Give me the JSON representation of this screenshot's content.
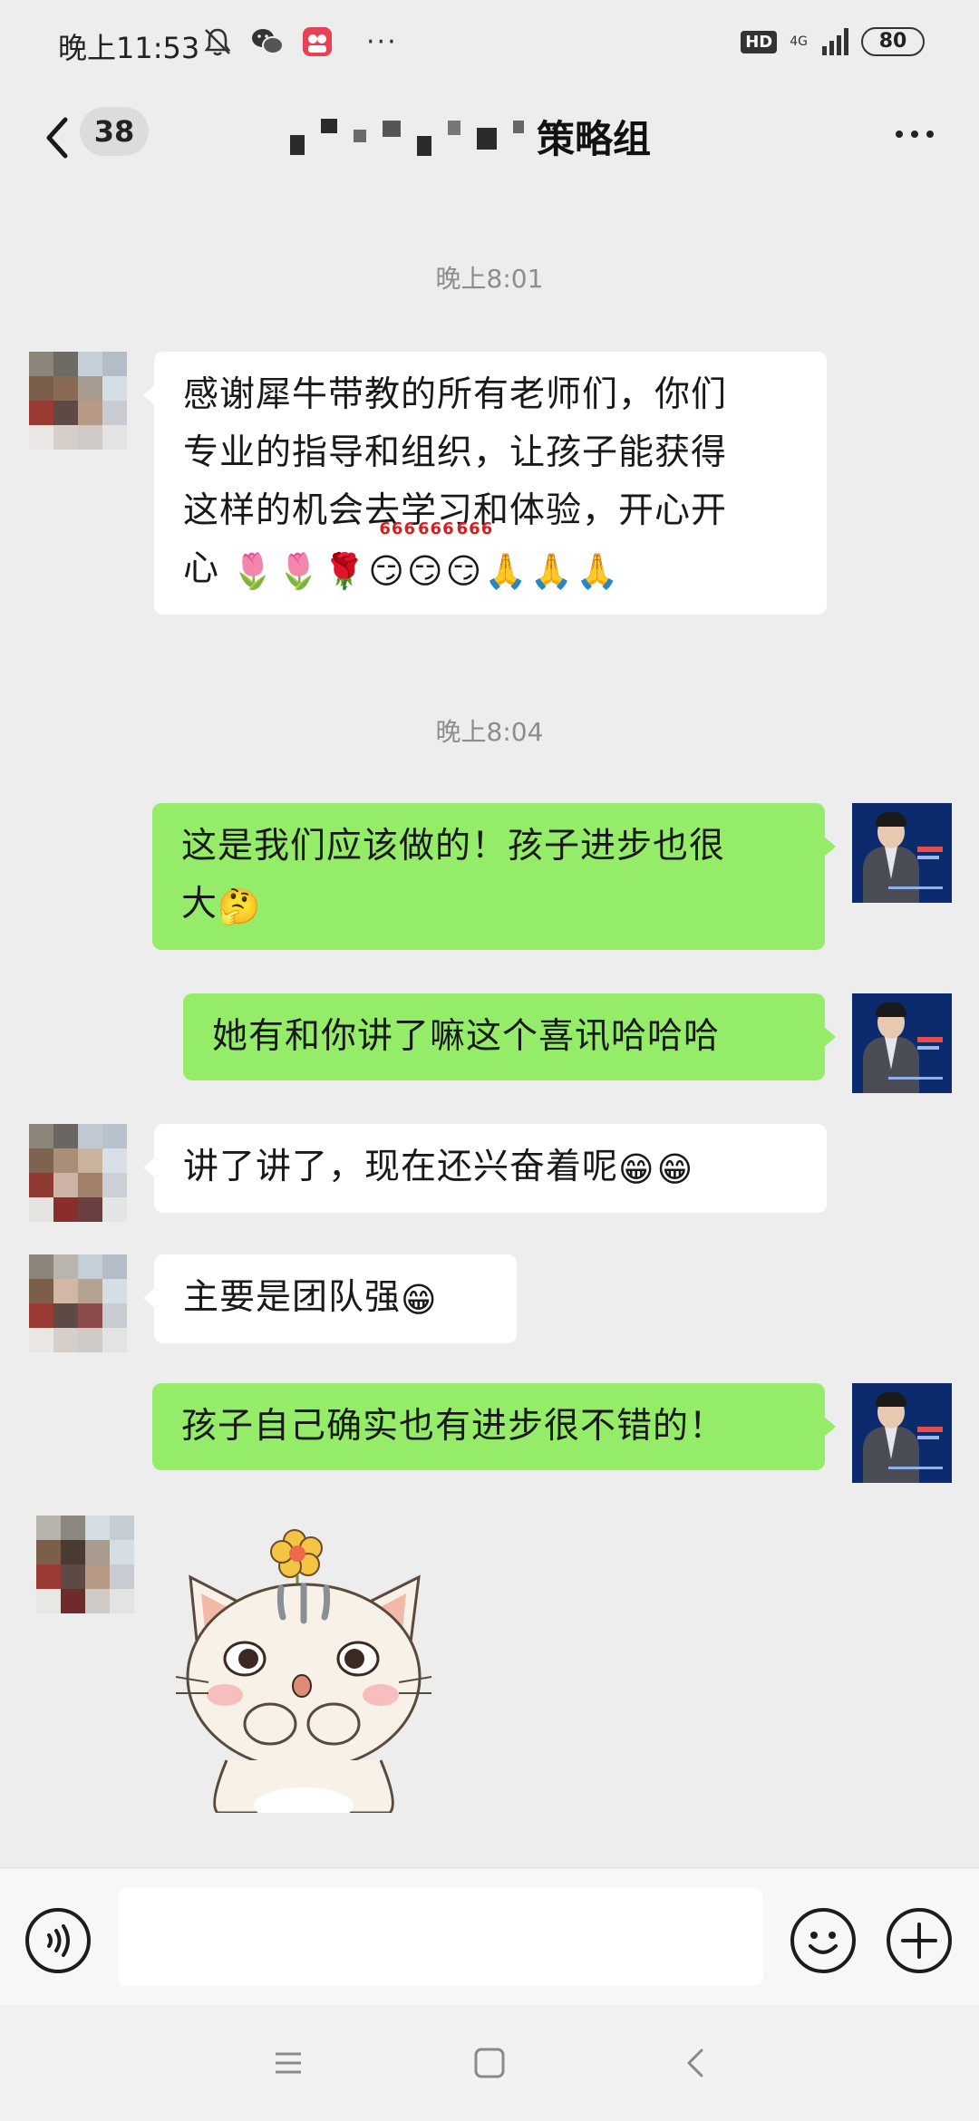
{
  "status_bar": {
    "time": "晚上11:53",
    "hd": "HD",
    "network": "4G",
    "battery": "80",
    "more": "···"
  },
  "nav": {
    "unread_count": "38",
    "title_visible": "策略组"
  },
  "timestamps": [
    "晚上8:01",
    "晚上8:04"
  ],
  "messages": [
    {
      "side": "left",
      "lines": [
        "感谢犀牛带教的所有老师们，你们",
        "专业的指导和组织，让孩子能获得",
        "这样的机会去学习和体验，开心开",
        "心"
      ],
      "emojis": [
        "🌷",
        "🌷",
        "🌹",
        "😏",
        "😏",
        "😏",
        "🙏",
        "🙏",
        "🙏"
      ]
    },
    {
      "side": "right",
      "lines": [
        "这是我们应该做的！孩子进步也很",
        "大"
      ],
      "emojis": [
        "🤔"
      ]
    },
    {
      "side": "right",
      "lines": [
        "她有和你讲了嘛这个喜讯哈哈哈"
      ],
      "emojis": []
    },
    {
      "side": "left",
      "lines": [
        "讲了讲了，现在还兴奋着呢"
      ],
      "emojis": [
        "😁",
        "😁"
      ]
    },
    {
      "side": "left",
      "lines": [
        "主要是团队强"
      ],
      "emojis": [
        "😁"
      ]
    },
    {
      "side": "right",
      "lines": [
        "孩子自己确实也有进步很不错的！"
      ],
      "emojis": []
    }
  ],
  "emoji_badge_text": "666",
  "colors": {
    "background": "#ededed",
    "bubble_self": "#95ec69",
    "bubble_other": "#ffffff",
    "timestamp": "#8c8c8c",
    "teacher_avatar": "#0b2b6e"
  },
  "icons": {
    "back": "chevron-left-icon",
    "more": "more-dots-icon",
    "voice": "voice-icon",
    "emoji": "emoji-icon",
    "plus": "plus-icon",
    "sys_menu": "menu-icon",
    "sys_home": "home-square-icon",
    "sys_back": "back-triangle-icon"
  }
}
